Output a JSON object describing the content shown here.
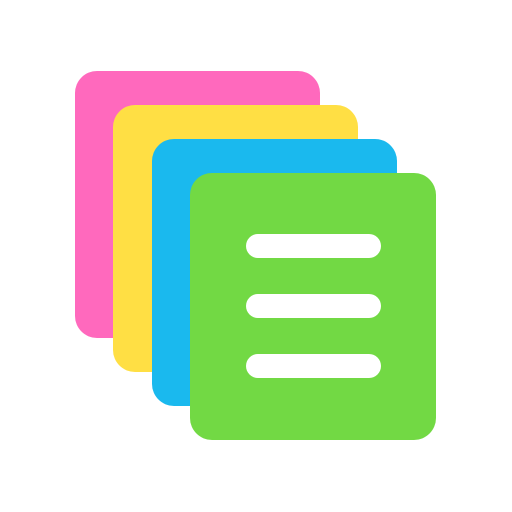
{
  "icon": {
    "name": "sticky-notes-stack-icon",
    "background": "#ffffff",
    "notes": [
      {
        "id": "pink",
        "color": "#ff69bd"
      },
      {
        "id": "yellow",
        "color": "#ffdf44"
      },
      {
        "id": "blue",
        "color": "#1ab9ee"
      },
      {
        "id": "green",
        "color": "#72d944"
      }
    ],
    "lines": {
      "count": 3,
      "color": "#ffffff"
    }
  }
}
